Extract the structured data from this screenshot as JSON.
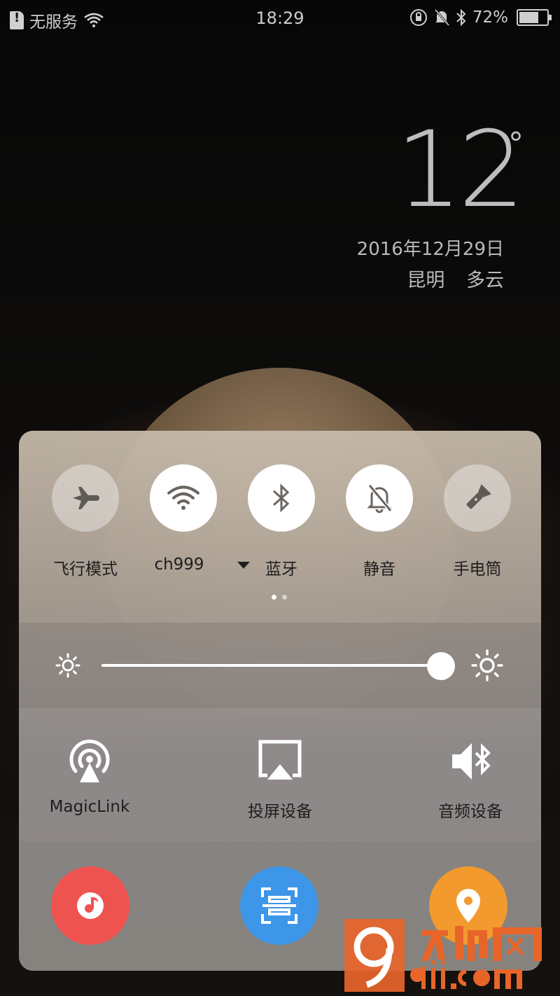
{
  "status_bar": {
    "carrier": "无服务",
    "time": "18:29",
    "battery": "72%",
    "battery_level": 0.72
  },
  "lockscreen": {
    "temperature": "12",
    "degree_symbol": "°",
    "date": "2016年12月29日",
    "location": "昆明 多云"
  },
  "quick_toggles": [
    {
      "label": "飞行模式",
      "icon": "airplane-icon",
      "state": "off"
    },
    {
      "label": "ch999",
      "icon": "wifi-icon",
      "state": "on"
    },
    {
      "label": "蓝牙",
      "icon": "bluetooth-icon",
      "state": "on"
    },
    {
      "label": "静音",
      "icon": "bell-off-icon",
      "state": "on"
    },
    {
      "label": "手电筒",
      "icon": "flashlight-icon",
      "state": "off"
    }
  ],
  "page_indicator": {
    "pages": 2,
    "current": 1
  },
  "brightness": {
    "level": 1.0
  },
  "devices": [
    {
      "label": "MagicLink",
      "icon": "magiclink-icon"
    },
    {
      "label": "投屏设备",
      "icon": "cast-screen-icon"
    },
    {
      "label": "音频设备",
      "icon": "audio-device-icon"
    }
  ],
  "shortcuts": [
    {
      "icon": "music-icon",
      "color": "#ef5350"
    },
    {
      "icon": "scan-icon",
      "color": "#3d96e8"
    },
    {
      "icon": "location-pin-icon",
      "color": "#f39a2e"
    }
  ],
  "watermark": {
    "text": "九机网 9ji.com",
    "color": "#e8652a"
  }
}
